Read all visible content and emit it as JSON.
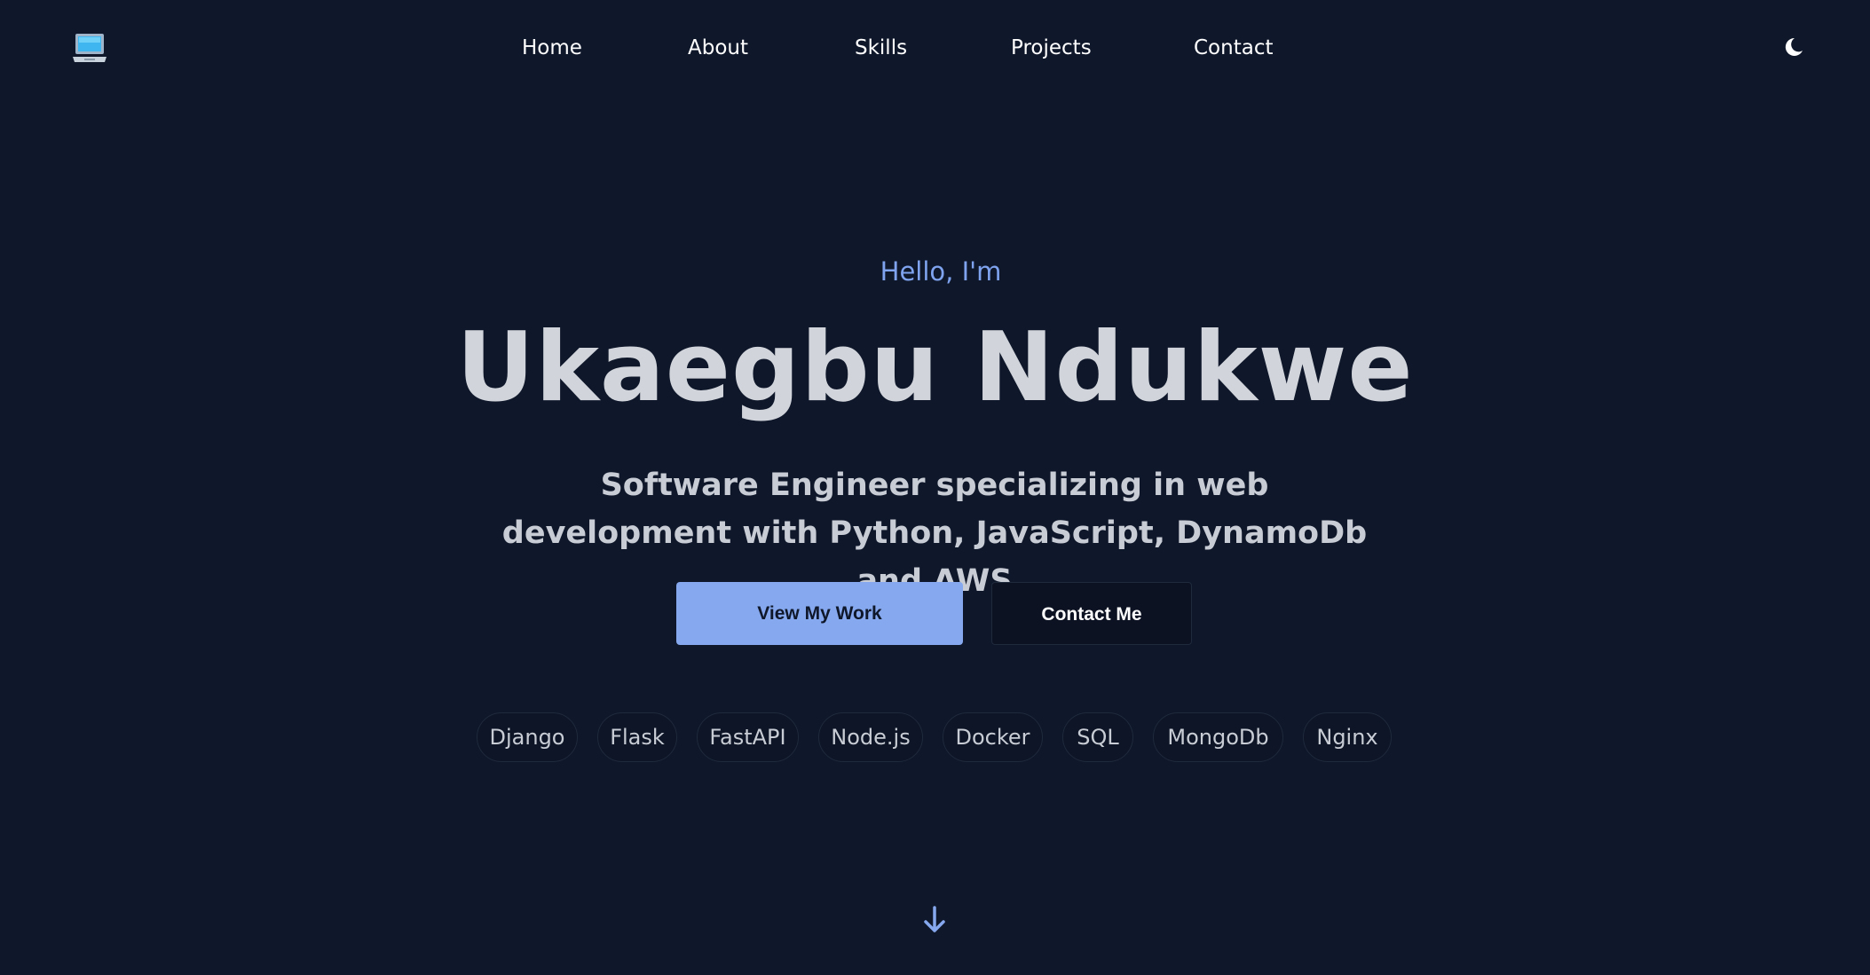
{
  "header": {
    "logo_icon": "laptop-icon",
    "nav": [
      {
        "label": "Home"
      },
      {
        "label": "About"
      },
      {
        "label": "Skills"
      },
      {
        "label": "Projects"
      },
      {
        "label": "Contact"
      }
    ],
    "theme_toggle_icon": "moon-icon"
  },
  "hero": {
    "greeting": "Hello, I'm",
    "name": "Ukaegbu Ndukwe",
    "tagline": "Software Engineer specializing in web development with Python, JavaScript, DynamoDb and AWS",
    "primary_button": "View My Work",
    "secondary_button": "Contact Me",
    "skills": [
      "Django",
      "Flask",
      "FastAPI",
      "Node.js",
      "Docker",
      "SQL",
      "MongoDb",
      "Nginx"
    ],
    "scroll_icon": "arrow-down-icon"
  },
  "colors": {
    "background": "#0f172a",
    "accent": "#86a8ee",
    "greeting": "#7fa3ee",
    "text": "#d1d5db"
  }
}
